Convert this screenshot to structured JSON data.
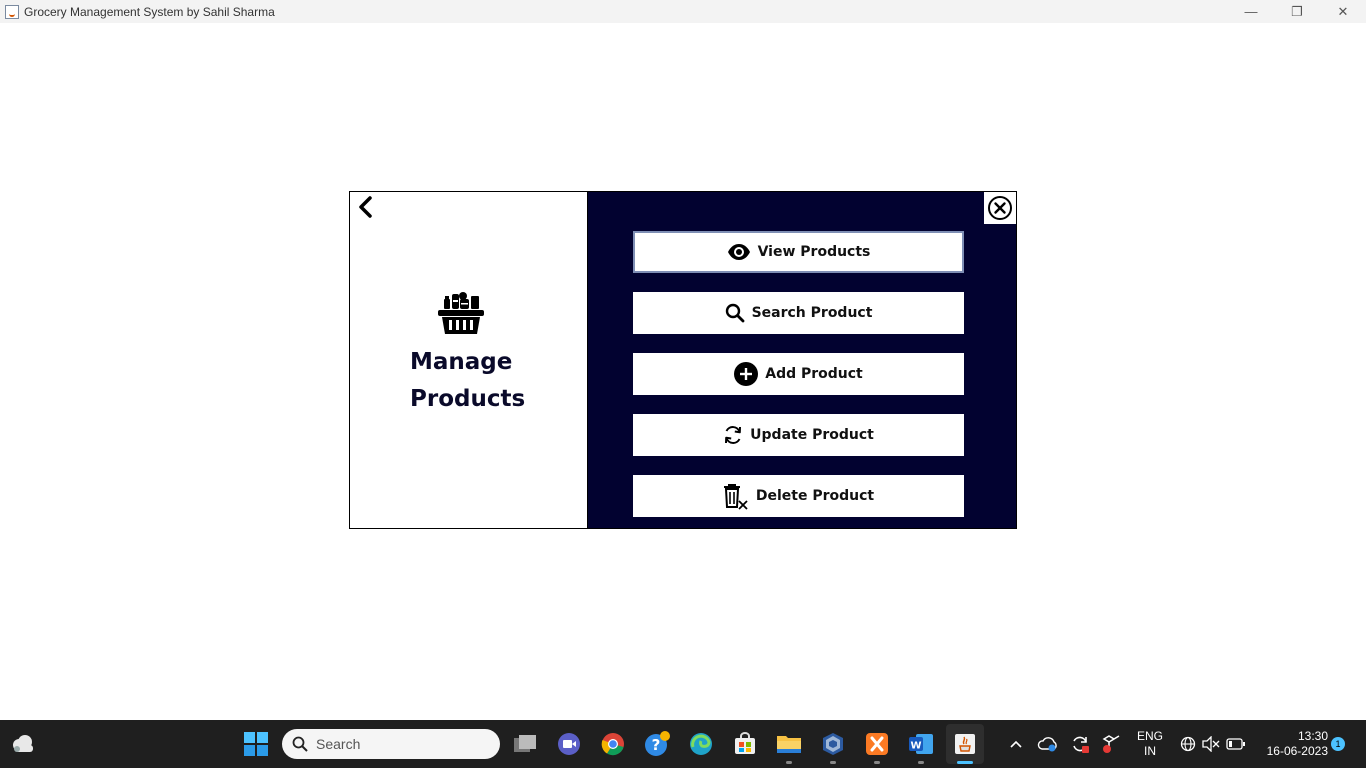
{
  "window": {
    "title": "Grocery Management System by Sahil Sharma",
    "minimize": "—",
    "restore": "❐",
    "close": "✕"
  },
  "dialog": {
    "title": "Manage Products",
    "title_line1": "Manage",
    "title_line2": "Products",
    "accent_color": "#020230",
    "buttons": [
      {
        "label": "View Products",
        "icon": "eye-icon"
      },
      {
        "label": "Search Product",
        "icon": "search-icon"
      },
      {
        "label": "Add Product",
        "icon": "plus-circle-icon"
      },
      {
        "label": "Update Product",
        "icon": "refresh-icon"
      },
      {
        "label": "Delete Product",
        "icon": "trash-icon"
      }
    ]
  },
  "taskbar": {
    "search_placeholder": "Search",
    "language_line1": "ENG",
    "language_line2": "IN",
    "time": "13:30",
    "date": "16-06-2023",
    "notification_count": "1",
    "apps": [
      "start",
      "search",
      "task-view",
      "meet",
      "chrome",
      "help",
      "edge",
      "store",
      "file-explorer",
      "virtualbox",
      "xampp",
      "word",
      "java"
    ]
  }
}
